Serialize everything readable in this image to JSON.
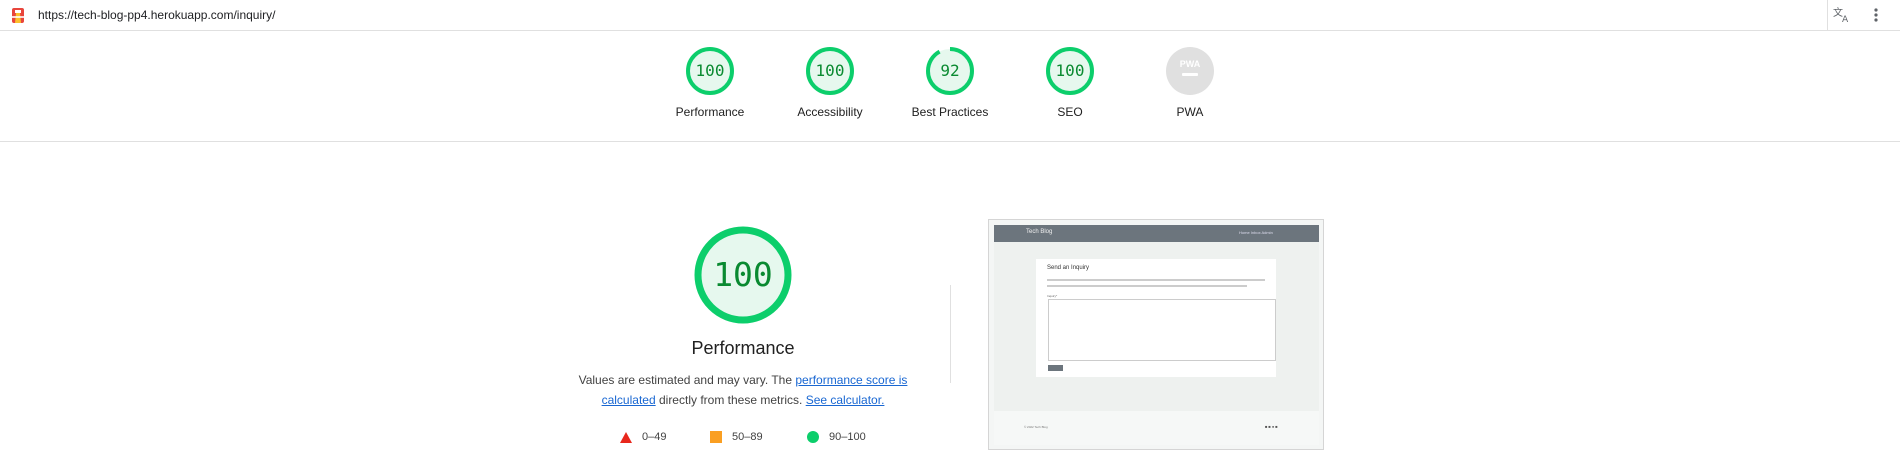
{
  "browser": {
    "url": "https://tech-blog-pp4.herokuapp.com/inquiry/",
    "logo_icon": "lighthouse-icon",
    "translate_icon": "translate-icon",
    "menu_icon": "kebab-menu-icon"
  },
  "summary": {
    "items": [
      {
        "label": "Performance",
        "score": "100",
        "fraction": 1.0
      },
      {
        "label": "Accessibility",
        "score": "100",
        "fraction": 1.0
      },
      {
        "label": "Best Practices",
        "score": "92",
        "fraction": 0.92
      },
      {
        "label": "SEO",
        "score": "100",
        "fraction": 1.0
      },
      {
        "label": "PWA",
        "badge": "PWA"
      }
    ]
  },
  "performance": {
    "score": "100",
    "title": "Performance",
    "desc_prefix": "Values are estimated and may vary. The ",
    "desc_link1": "performance score is calculated",
    "desc_middle": " directly from these metrics. ",
    "desc_link2": "See calculator.",
    "legend": [
      {
        "range": "0–49",
        "color": "#e8271c"
      },
      {
        "range": "50–89",
        "color": "#fa9f22"
      },
      {
        "range": "90–100",
        "color": "#0cce6b"
      }
    ]
  },
  "screenshot": {
    "brand": "Tech Blog",
    "nav_links": "Home  Inbox  Admin",
    "card_title": "Send an Inquiry",
    "field_label": "Inquiry*",
    "footer_copy": "© 2022 Tech Blog"
  },
  "colors": {
    "pass": "#0cce6b",
    "pass_text": "#0a8a31",
    "pass_fill": "#e6f8ee",
    "na": "#e0e0e0"
  }
}
